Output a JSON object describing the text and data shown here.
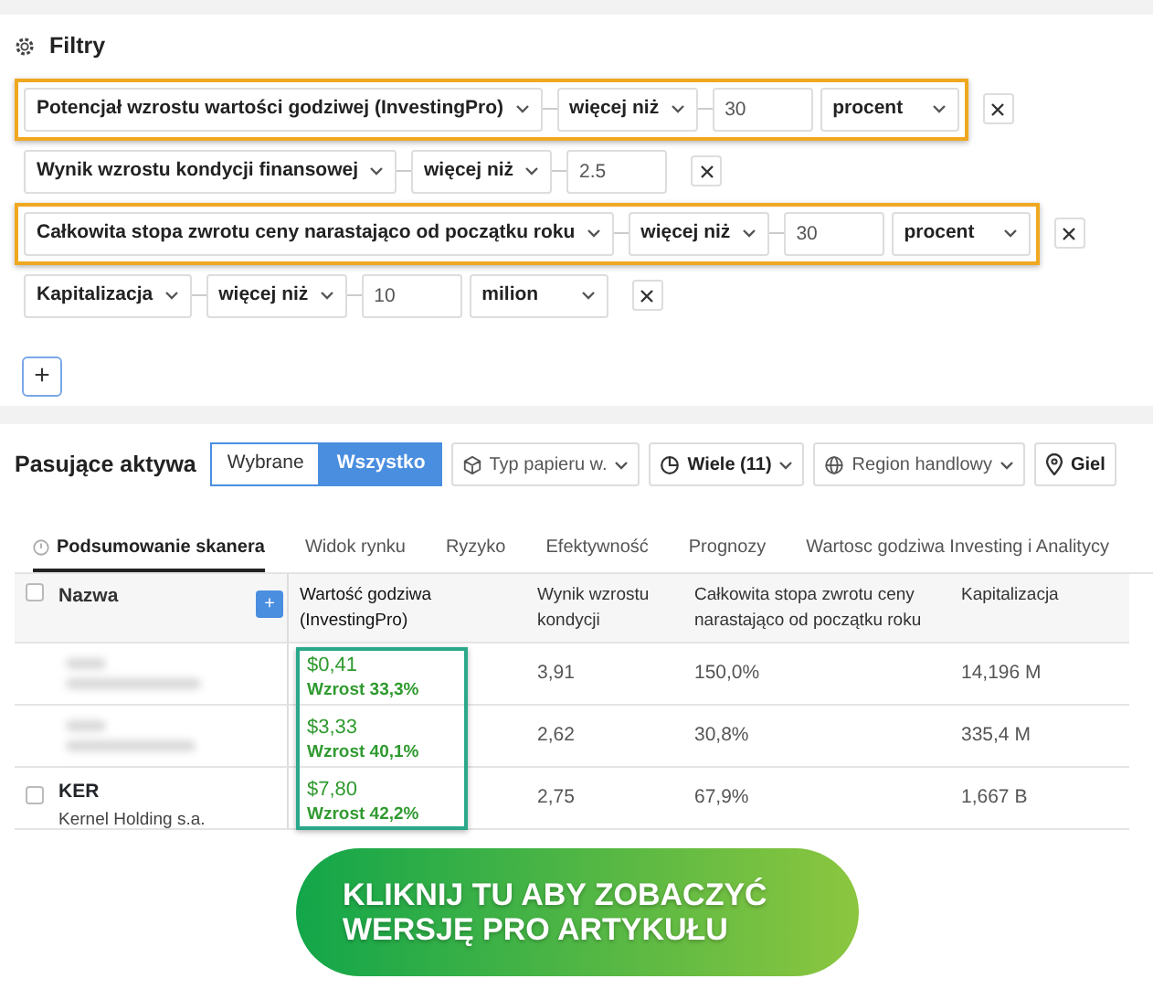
{
  "filters": {
    "title": "Filtry",
    "add_button": "+",
    "rows": [
      {
        "field": "Potencjał wzrostu wartości godziwej (InvestingPro)",
        "operator": "więcej niż",
        "value": "30",
        "unit": "procent",
        "highlighted": true
      },
      {
        "field": "Wynik wzrostu kondycji finansowej",
        "operator": "więcej niż",
        "value": "2.5",
        "highlighted": false
      },
      {
        "field": "Całkowita stopa zwrotu ceny narastająco od początku roku",
        "operator": "więcej niż",
        "value": "30",
        "unit": "procent",
        "highlighted": true
      },
      {
        "field": "Kapitalizacja",
        "operator": "więcej niż",
        "value": "10",
        "unit": "milion",
        "highlighted": false
      }
    ]
  },
  "results": {
    "title": "Pasujące aktywa",
    "toggle": [
      {
        "label": "Wybrane",
        "selected": false
      },
      {
        "label": "Wszystko",
        "selected": true
      }
    ],
    "dropdowns": [
      {
        "label": "Typ papieru w.",
        "bold": false
      },
      {
        "label": "Wiele (11)",
        "bold": true
      },
      {
        "label": "Region handlowy",
        "bold": false
      },
      {
        "label": "Giel",
        "bold": true
      }
    ]
  },
  "tabs": [
    {
      "label": "Podsumowanie skanera",
      "selected": true
    },
    {
      "label": "Widok rynku",
      "selected": false
    },
    {
      "label": "Ryzyko",
      "selected": false
    },
    {
      "label": "Efektywność",
      "selected": false
    },
    {
      "label": "Prognozy",
      "selected": false
    },
    {
      "label": "Wartosc godziwa Investing i Analitycy",
      "selected": false
    }
  ],
  "table": {
    "add_column_button": "+",
    "select_all_checked": false,
    "columns": [
      {
        "label": "Nazwa",
        "highlighted": false
      },
      {
        "label": "Wartość godziwa (InvestingPro)",
        "highlighted": true
      },
      {
        "label": "Wynik wzrostu kondycji",
        "highlighted": false
      },
      {
        "label": "Całkowita stopa zwrotu ceny narastająco od początku roku",
        "highlighted": false
      },
      {
        "label": "Kapitalizacja",
        "highlighted": false
      }
    ],
    "rows": [
      {
        "redacted": true,
        "fair_value": "$0,41",
        "upside": "Wzrost 33,3%",
        "score": "3,91",
        "return": "150,0%",
        "cap": "14,196 M"
      },
      {
        "redacted": true,
        "fair_value": "$3,33",
        "upside": "Wzrost 40,1%",
        "score": "2,62",
        "return": "30,8%",
        "cap": "335,4 M"
      },
      {
        "redacted": false,
        "checked": false,
        "ticker": "KER",
        "company": "Kernel Holding s.a.",
        "fair_value": "$7,80",
        "upside": "Wzrost 42,2%",
        "score": "2,75",
        "return": "67,9%",
        "cap": "1,667 B"
      }
    ]
  },
  "cta": {
    "lines": [
      "KLIKNIJ TU ABY ZOBACZYĆ",
      "WERSJĘ PRO ARTYKUŁU"
    ]
  }
}
